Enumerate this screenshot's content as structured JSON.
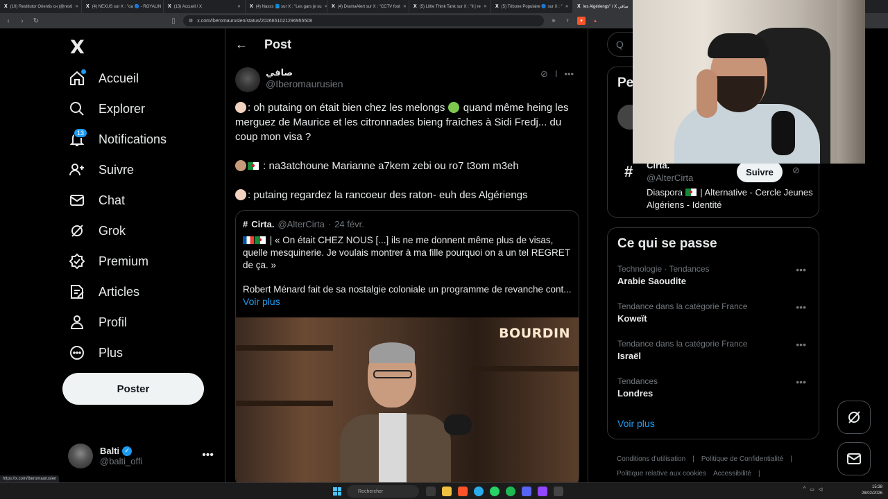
{
  "browser": {
    "tabs": [
      {
        "label": "(10) Restitutor Orientis сн (@resti"
      },
      {
        "label": "(4) NEXUS sur X : \"oa 🔵 - ROYALIN"
      },
      {
        "label": "(13) Accueil / X"
      },
      {
        "label": "(4) Nasss 📘 sur X : \"Les gars je su"
      },
      {
        "label": "(4) DramaAlert sur X : \"CCTV foot"
      },
      {
        "label": "(5) Little Think Tank sur X : \"Il | re"
      },
      {
        "label": "(5) Tribune Populaire 🔵 sur X : \""
      },
      {
        "label": "les Algériengs\" / X صافي"
      }
    ],
    "url": "x.com/Iberomaurusien/status/2026651021296955508",
    "status_link": "https://x.com/Iberomaurusien"
  },
  "nav": {
    "logo": "X",
    "items": [
      {
        "label": "Accueil",
        "icon": "home-icon"
      },
      {
        "label": "Explorer",
        "icon": "search-icon"
      },
      {
        "label": "Notifications",
        "icon": "bell-icon",
        "badge": "13"
      },
      {
        "label": "Suivre",
        "icon": "follow-icon"
      },
      {
        "label": "Chat",
        "icon": "mail-icon"
      },
      {
        "label": "Grok",
        "icon": "grok-icon"
      },
      {
        "label": "Premium",
        "icon": "premium-icon"
      },
      {
        "label": "Articles",
        "icon": "articles-icon"
      },
      {
        "label": "Profil",
        "icon": "profile-icon"
      },
      {
        "label": "Plus",
        "icon": "more-icon"
      }
    ],
    "post_button": "Poster",
    "account": {
      "name": "Balti",
      "handle": "@balti_offi"
    }
  },
  "main": {
    "title": "Post",
    "author": {
      "name": "صافي",
      "handle": "@Iberomaurusien"
    },
    "post_lines": [
      ": oh putaing on était bien chez les melongs",
      " quand même heing les merguez de Maurice et les citronnades bieng fraîches à Sidi Fredj... du coup mon visa ?",
      " : na3atchoune Marianne a7kem zebi ou ro7 t3om m3eh",
      ": putaing regardez la rancoeur des raton- euh des Algériengs"
    ],
    "quote": {
      "name": "Cirta.",
      "handle": "@AlterCirta",
      "date": "24 févr.",
      "text": " | « On était CHEZ NOUS [...] ils ne me donnent même plus de visas, quelle mesquinerie. Je voulais montrer à ma fille pourquoi on a un tel REGRET de ça. »",
      "text2": "Robert Ménard fait de sa nostalgie coloniale un programme de revanche cont...",
      "show_more": "Voir plus",
      "media_label": "BOURDIN"
    }
  },
  "right": {
    "search_stub": "Q",
    "reco": {
      "title": "Pe",
      "name": "Cirta.",
      "handle": "@AlterCirta",
      "follow": "Suivre",
      "bio_pre": "Diaspora ",
      "bio_post": " | Alternative - Cercle Jeunes Algériens - Identité"
    },
    "trends": {
      "title": "Ce qui se passe",
      "items": [
        {
          "category": "Technologie · Tendances",
          "name": "Arabie Saoudite"
        },
        {
          "category": "Tendance dans la catégorie France",
          "name": "Koweït"
        },
        {
          "category": "Tendance dans la catégorie France",
          "name": "Israël"
        },
        {
          "category": "Tendances",
          "name": "Londres"
        }
      ],
      "show_more": "Voir plus"
    },
    "footer": [
      "Conditions d'utilisation",
      "|",
      "Politique de Confidentialité",
      "|",
      "Politique relative aux cookies",
      "Accessibilité",
      "|"
    ]
  },
  "taskbar": {
    "search": "Rechercher",
    "time": "15:38",
    "date": "28/02/2026"
  },
  "colors": {
    "accent": "#1d9bf0",
    "background": "#000000",
    "border": "#2f3336",
    "muted": "#71767b"
  }
}
